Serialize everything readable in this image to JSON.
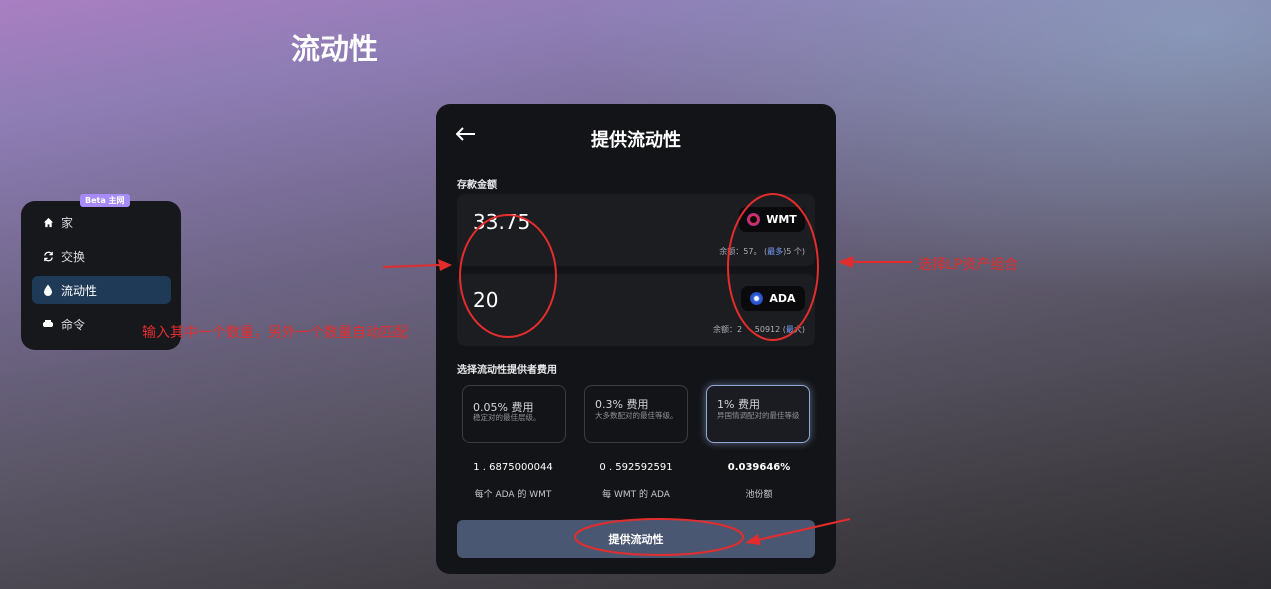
{
  "page": {
    "title": "流动性"
  },
  "sidebar": {
    "badge": "Beta 主网",
    "items": [
      {
        "label": "家",
        "icon": "home-icon"
      },
      {
        "label": "交换",
        "icon": "swap-icon"
      },
      {
        "label": "流动性",
        "icon": "droplet-icon",
        "active": true
      },
      {
        "label": "命令",
        "icon": "command-icon"
      }
    ]
  },
  "card": {
    "title": "提供流动性",
    "deposit_label": "存款金额",
    "token_a": {
      "amount": "33.75",
      "symbol": "WMT",
      "balance_prefix": "余额：57",
      "balance_mid": "。 (",
      "max": "最多",
      "balance_suffix": ")5 个)"
    },
    "token_b": {
      "amount": "20",
      "symbol": "ADA",
      "balance_prefix": "余额：2",
      "balance_mid": "     50912 (",
      "max": "最",
      "balance_suffix": "大)"
    },
    "fee_label": "选择流动性提供者费用",
    "fees": [
      {
        "title": "0.05% 费用",
        "desc": "稳定对的最佳层级。"
      },
      {
        "title": "0.3% 费用",
        "desc": "大多数配对的最佳等级。"
      },
      {
        "title": "1% 费用",
        "desc": "异国情调配对的最佳等级"
      }
    ],
    "stats": [
      {
        "value": "1 . 6875000044",
        "label": "每个 ADA 的 WMT"
      },
      {
        "value": "0 . 592592591",
        "label": "每 WMT 的 ADA"
      },
      {
        "value": "0.039646%",
        "label": "池份额"
      }
    ],
    "submit_label": "提供流动性"
  },
  "annotations": {
    "left": "输入其中一个数量，另外一个数量自动匹配",
    "right": "选择LP资产组合"
  },
  "colors": {
    "annotation": "#e32d2d",
    "active_nav": "#1f3a57",
    "submit": "#4a5772"
  }
}
